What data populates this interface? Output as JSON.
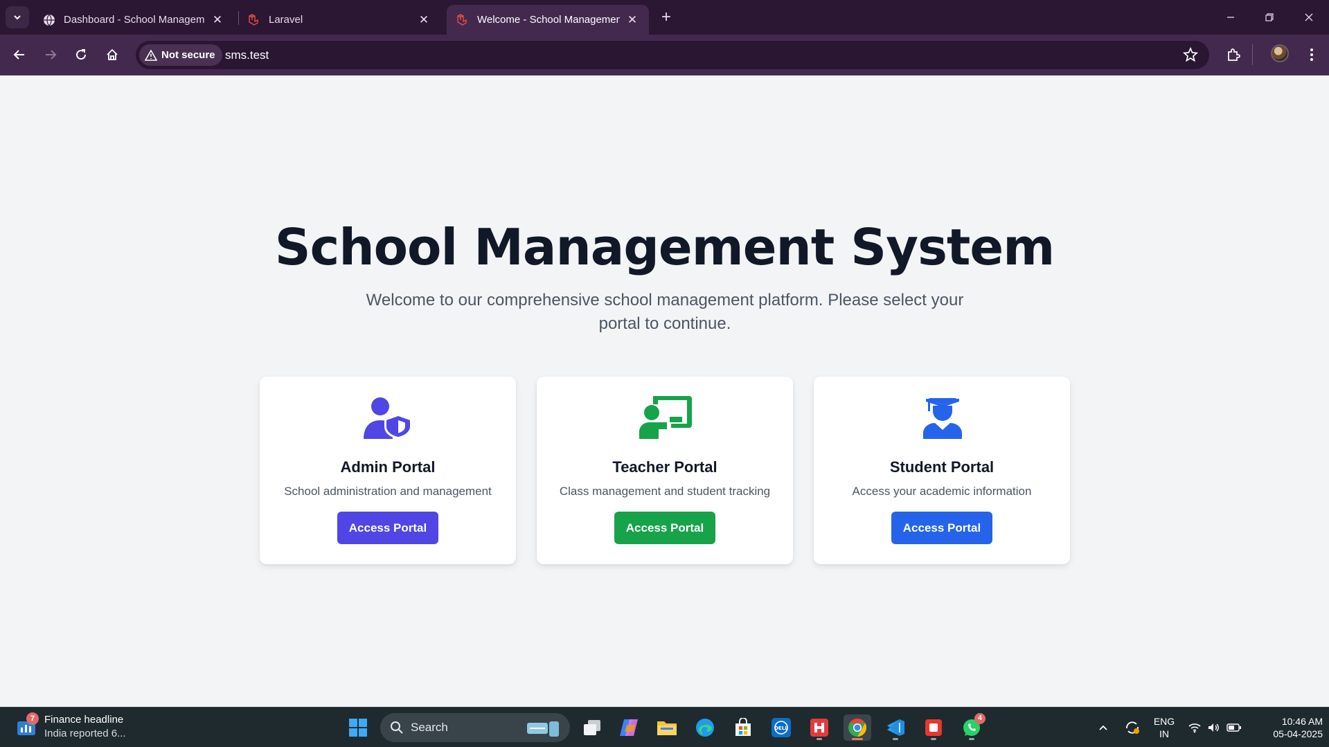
{
  "browser": {
    "tabs": [
      {
        "title": "Dashboard - School Manageme",
        "icon": "globe-icon",
        "active": false
      },
      {
        "title": "Laravel",
        "icon": "laravel-icon",
        "active": false
      },
      {
        "title": "Welcome - School Managemen",
        "icon": "laravel-icon",
        "active": true
      }
    ],
    "address": {
      "security_label": "Not secure",
      "url": "sms.test"
    }
  },
  "hero": {
    "title": "School Management System",
    "subtitle": "Welcome to our comprehensive school management platform. Please select your portal to continue."
  },
  "portals": [
    {
      "title": "Admin Portal",
      "description": "School administration and management",
      "button": "Access Portal",
      "icon": "admin-shield-user-icon",
      "color": "#4f46e5"
    },
    {
      "title": "Teacher Portal",
      "description": "Class management and student tracking",
      "button": "Access Portal",
      "icon": "teacher-board-icon",
      "color": "#16a34a"
    },
    {
      "title": "Student Portal",
      "description": "Access your academic information",
      "button": "Access Portal",
      "icon": "graduate-icon",
      "color": "#2563eb"
    }
  ],
  "taskbar": {
    "news": {
      "title": "Finance headline",
      "subtitle": "India reported 6...",
      "badge": "7"
    },
    "search_label": "Search",
    "whatsapp_badge": "4",
    "language": {
      "line1": "ENG",
      "line2": "IN"
    },
    "clock": {
      "time": "10:46 AM",
      "date": "05-04-2025"
    }
  }
}
